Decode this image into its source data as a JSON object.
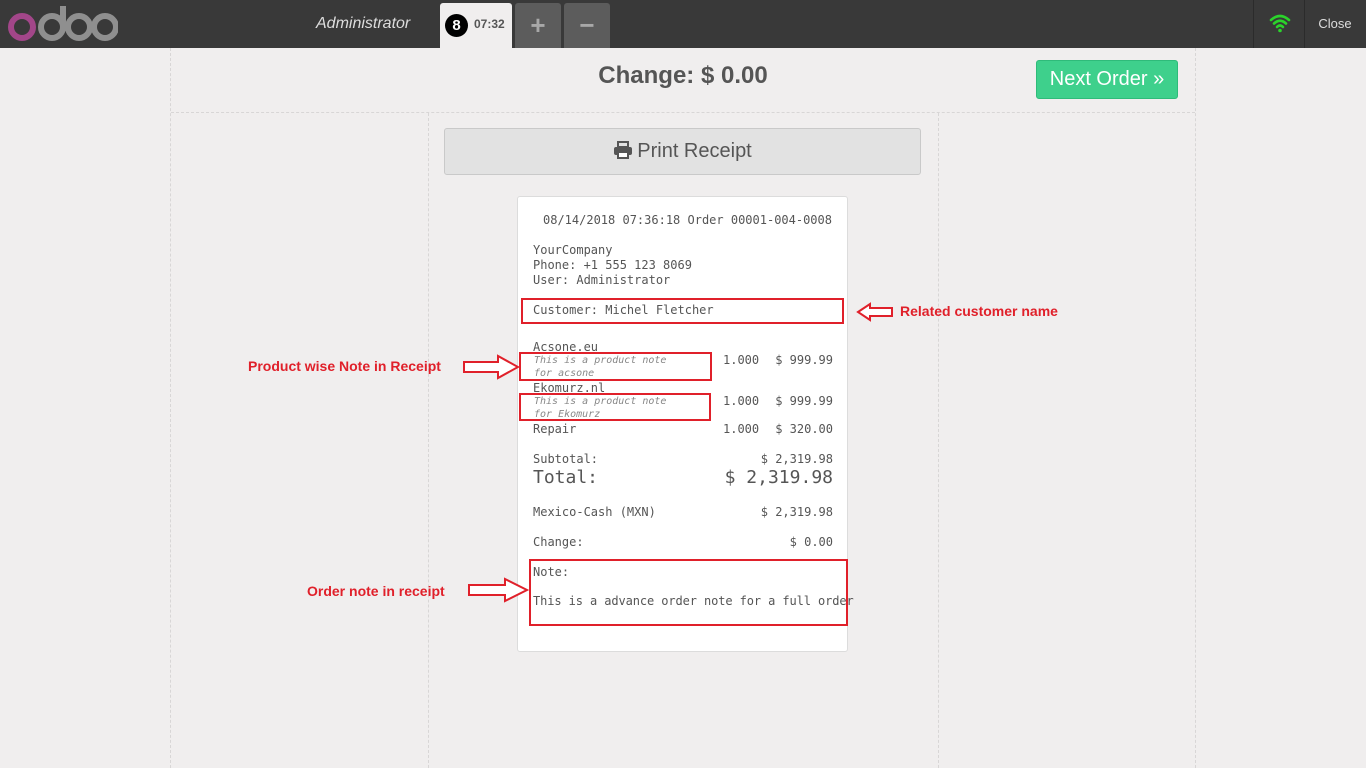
{
  "header": {
    "logo_text": "odoo",
    "cashier": "Administrator",
    "order_tab": {
      "number": "8",
      "time": "07:32"
    },
    "add_order_label": "+",
    "remove_order_label": "−",
    "close_label": "Close"
  },
  "screen": {
    "change_title": "Change: $ 0.00",
    "next_order_label": "Next Order »",
    "print_receipt_label": "Print Receipt"
  },
  "receipt": {
    "header_line": "08/14/2018 07:36:18 Order 00001-004-0008",
    "company": "YourCompany",
    "phone": "Phone: +1 555 123 8069",
    "user": "User: Administrator",
    "customer": "Customer: Michel Fletcher",
    "lines": [
      {
        "product": "Acsone.eu",
        "note_1": "This is a product note",
        "note_2": "for acsone",
        "qty": "1.000",
        "price": "$ 999.99"
      },
      {
        "product": "Ekomurz.nl",
        "note_1": "This is a product note",
        "note_2": "for Ekomurz",
        "qty": "1.000",
        "price": "$ 999.99"
      },
      {
        "product": "Repair",
        "qty": "1.000",
        "price": "$ 320.00"
      }
    ],
    "subtotal_label": "Subtotal:",
    "subtotal_value": "$ 2,319.98",
    "total_label": "Total:",
    "total_value": "$ 2,319.98",
    "payment_label": "Mexico-Cash (MXN)",
    "payment_value": "$ 2,319.98",
    "change_label": "Change:",
    "change_value": "$ 0.00",
    "note_label": "Note:",
    "note_text": "This is a advance order note for a full order"
  },
  "annotations": {
    "customer": "Related customer name",
    "product_note": "Product wise Note in Receipt",
    "order_note": "Order note in receipt",
    "color": "#e0202a"
  },
  "colors": {
    "topbar": "#393939",
    "background": "#f0eeee",
    "next_order": "#3ed08c",
    "logo_o": "#a24689",
    "logo_doo": "#8f8f8f",
    "wifi": "#2bd32b"
  }
}
